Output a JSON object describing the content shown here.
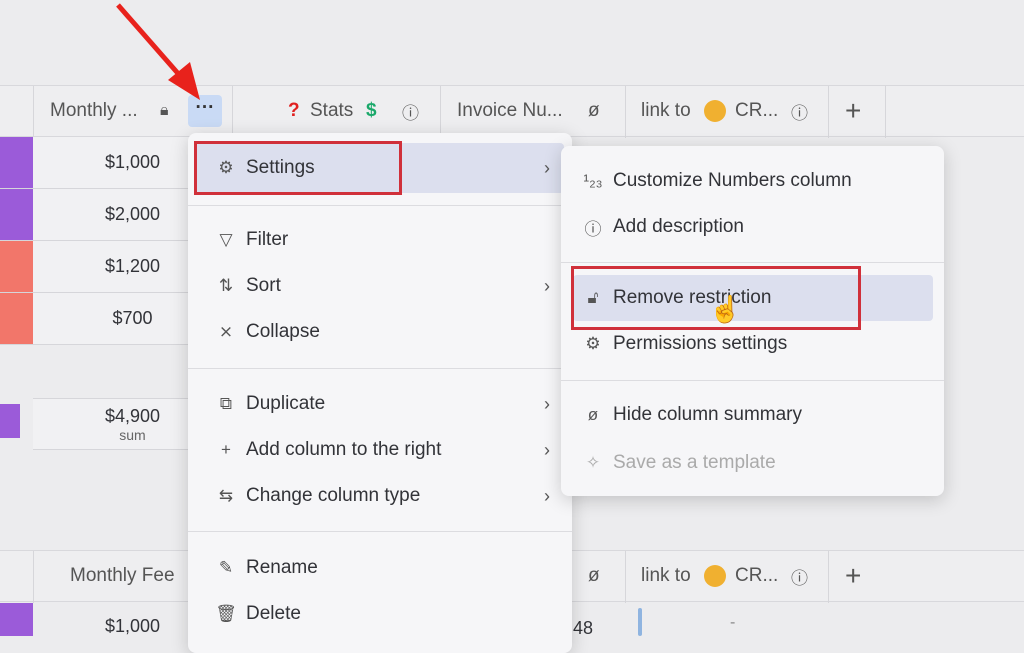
{
  "header": {
    "col1": "Monthly ...",
    "col2_prefix": "?",
    "col2": "Stats",
    "col2_suffix": "$",
    "col3": "Invoice Nu...",
    "col4_prefix": "link to",
    "col4_suffix": "CR...",
    "add": "+"
  },
  "rows": [
    {
      "value": "$1,000",
      "color": "#9b5bd9"
    },
    {
      "value": "$2,000",
      "color": "#9b5bd9"
    },
    {
      "value": "$1,200",
      "color": "#f2766a"
    },
    {
      "value": "$700",
      "color": "#f2766a"
    }
  ],
  "summary": {
    "value": "$4,900",
    "label": "sum"
  },
  "group2": {
    "col1": "Monthly Fee",
    "col4_prefix": "link to",
    "col4_suffix": "CR...",
    "add": "+",
    "row1": "$1,000",
    "row1_partial": "48",
    "row1_link": "-"
  },
  "menu": {
    "items": [
      {
        "label": "Settings",
        "icon": "gear-icon"
      },
      {
        "label": "Filter",
        "icon": "filter-icon"
      },
      {
        "label": "Sort",
        "icon": "sort-icon"
      },
      {
        "label": "Collapse",
        "icon": "collapse-icon"
      },
      {
        "label": "Duplicate",
        "icon": "duplicate-icon"
      },
      {
        "label": "Add column to the right",
        "icon": "plus-icon"
      },
      {
        "label": "Change column type",
        "icon": "swap-icon"
      },
      {
        "label": "Rename",
        "icon": "pencil-icon"
      },
      {
        "label": "Delete",
        "icon": "trash-icon"
      }
    ]
  },
  "submenu": {
    "items": [
      {
        "label": "Customize Numbers column",
        "icon": "numbers-icon"
      },
      {
        "label": "Add description",
        "icon": "info-icon"
      },
      {
        "label": "Remove restriction",
        "icon": "unlock-icon"
      },
      {
        "label": "Permissions settings",
        "icon": "gear-icon"
      },
      {
        "label": "Hide column summary",
        "icon": "eye-off-icon"
      },
      {
        "label": "Save as a template",
        "icon": "wand-icon"
      }
    ]
  },
  "colors": {
    "highlight": "#d0303a",
    "accent_arrow": "#e8221c",
    "hover": "#dcdfee"
  }
}
